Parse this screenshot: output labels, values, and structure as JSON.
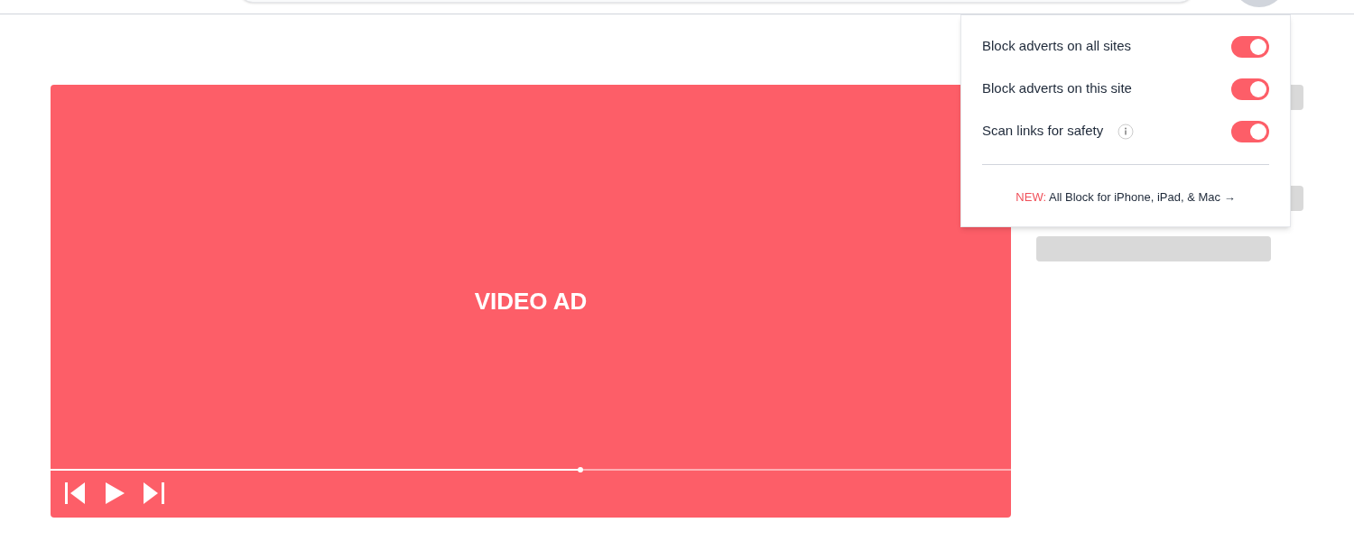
{
  "video": {
    "label": "VIDEO AD",
    "level": 0.552
  },
  "popup": {
    "toggles": [
      {
        "label": "Block adverts on all sites",
        "on": true,
        "info": false
      },
      {
        "label": "Block adverts on this site",
        "on": true,
        "info": false
      },
      {
        "label": "Scan links for safety",
        "on": true,
        "info": true
      }
    ],
    "link": {
      "tag": "NEW:",
      "text": "All Block for iPhone, iPad, & Mac →"
    }
  }
}
